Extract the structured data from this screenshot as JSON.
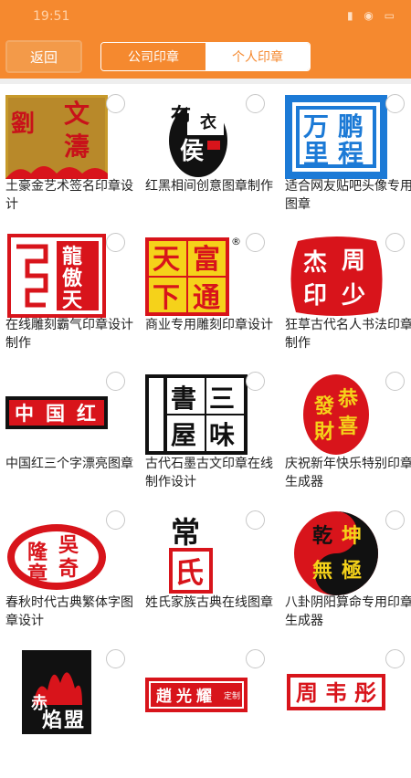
{
  "status": {
    "time": "19:51",
    "icons": "▮ ◉ ▭"
  },
  "toolbar": {
    "back_label": "返回",
    "tabs": [
      {
        "label": "公司印章"
      },
      {
        "label": "个人印章"
      }
    ]
  },
  "items": [
    {
      "caption": "土豪金艺术签名印章设计",
      "seal": [
        "劉",
        "文",
        "濤"
      ]
    },
    {
      "caption": "红黑相间创意图章制作",
      "seal": [
        "布",
        "衣",
        "侯"
      ]
    },
    {
      "caption": "适合网友贴吧头像专用图章",
      "seal": [
        "万",
        "鹏",
        "里",
        "程"
      ]
    },
    {
      "caption": "在线雕刻霸气印章设计制作",
      "seal": [
        "龍",
        "傲",
        "天"
      ]
    },
    {
      "caption": "商业专用雕刻印章设计",
      "seal": [
        "天",
        "富",
        "下",
        "通"
      ],
      "mark": "®"
    },
    {
      "caption": "狂草古代名人书法印章制作",
      "seal": [
        "杰",
        "周",
        "印",
        "少"
      ]
    },
    {
      "caption": "中国红三个字漂亮图章",
      "seal": [
        "中",
        "国",
        "红"
      ]
    },
    {
      "caption": "古代石墨古文印章在线制作设计",
      "seal": [
        "書",
        "三",
        "屋",
        "味"
      ]
    },
    {
      "caption": "庆祝新年快乐特别印章生成器",
      "seal": [
        "發",
        "恭",
        "財",
        "喜"
      ]
    },
    {
      "caption": "春秋时代古典繁体字图章设计",
      "seal": [
        "吳",
        "隆",
        "章",
        "奇"
      ]
    },
    {
      "caption": "姓氏家族古典在线图章",
      "seal": [
        "常",
        "氏"
      ]
    },
    {
      "caption": "八卦阴阳算命专用印章生成器",
      "seal": [
        "乾",
        "坤",
        "無",
        "極"
      ]
    },
    {
      "caption": "",
      "seal": [
        "赤",
        "焰",
        "盟"
      ]
    },
    {
      "caption": "",
      "seal": [
        "趙",
        "光",
        "耀",
        "定制"
      ]
    },
    {
      "caption": "",
      "seal": [
        "周",
        "韦",
        "彤"
      ]
    }
  ],
  "colors": {
    "accent": "#f5892f",
    "seal_red": "#d8141b",
    "gold": "#c79a2b",
    "blue": "#1c7ad6"
  }
}
